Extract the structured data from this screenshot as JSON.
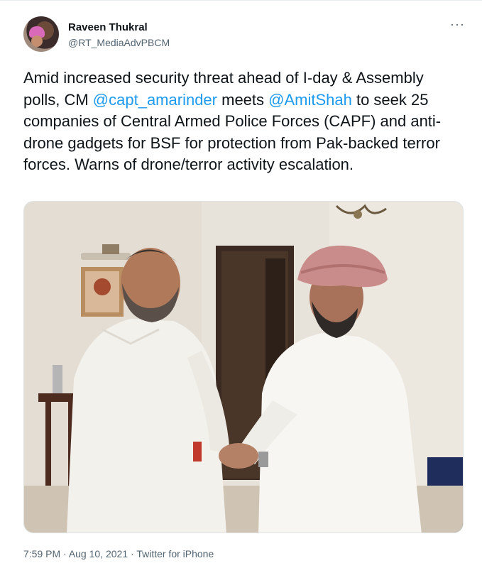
{
  "author": {
    "name": "Raveen Thukral",
    "handle": "@RT_MediaAdvPBCM"
  },
  "more_menu": "···",
  "tweet": {
    "text_1": "Amid increased security threat ahead of I-day & Assembly polls, CM ",
    "mention_1": "@capt_amarinder",
    "text_2": " meets ",
    "mention_2": "@AmitShah",
    "text_3": " to seek 25 companies of Central Armed Police Forces (CAPF) and anti-drone gadgets for BSF for protection from Pak-backed terror forces. Warns of drone/terror activity escalation."
  },
  "meta": {
    "time": "7:59 PM",
    "sep1": " · ",
    "date": "Aug 10, 2021",
    "sep2": " · ",
    "source": "Twitter for iPhone"
  },
  "colors": {
    "link": "#1d9bf0",
    "secondary_text": "#536471"
  }
}
